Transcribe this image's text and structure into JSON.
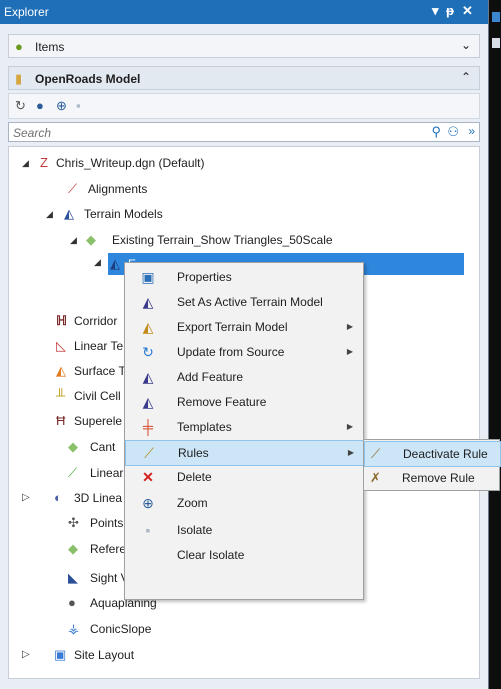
{
  "window": {
    "title": "Explorer",
    "pin": "↓ ‹",
    "close": "✕"
  },
  "sections": {
    "items": {
      "label": "Items",
      "chevron": "⌄"
    },
    "openroads": {
      "label": "OpenRoads Model",
      "chevron": "⌃"
    }
  },
  "search": {
    "placeholder": "Search"
  },
  "tree": {
    "root": "Chris_Writeup.dgn (Default)",
    "alignments": "Alignments",
    "terrain_models": "Terrain Models",
    "existing_terrain": "Existing Terrain_Show Triangles_50Scale",
    "selected_partial": "E",
    "corridors_partial": "Corridor",
    "linear_partial": "Linear Te",
    "surface_partial": "Surface T",
    "civil_cell_partial": "Civil Cell",
    "superelev_partial": "Superele",
    "cant": "Cant",
    "linear_g_partial": "Linear G",
    "threed_linear_partial": "3D Linea",
    "points": "Points",
    "reference_partial": "Referenc",
    "sight_visibility": "Sight Visibility Sections",
    "aquaplaning": "Aquaplaning",
    "conicslope": "ConicSlope",
    "site_layout": "Site Layout"
  },
  "context_menu": {
    "items": [
      {
        "label": "Properties",
        "has_submenu": false
      },
      {
        "label": "Set As Active Terrain Model",
        "has_submenu": false
      },
      {
        "label": "Export Terrain Model",
        "has_submenu": true
      },
      {
        "label": "Update from Source",
        "has_submenu": true
      },
      {
        "label": "Add Feature",
        "has_submenu": false
      },
      {
        "label": "Remove Feature",
        "has_submenu": false
      },
      {
        "label": "Templates",
        "has_submenu": true
      },
      {
        "label": "Rules",
        "has_submenu": true,
        "highlighted": true
      },
      {
        "label": "Delete",
        "has_submenu": false
      },
      {
        "label": "Zoom",
        "has_submenu": false
      },
      {
        "label": "Isolate",
        "has_submenu": false
      },
      {
        "label": "Clear Isolate",
        "has_submenu": false
      }
    ]
  },
  "rules_submenu": {
    "items": [
      {
        "label": "Deactivate Rule",
        "highlighted": true
      },
      {
        "label": "Remove Rule"
      }
    ]
  },
  "colors": {
    "titlebar": "#1f6fb8",
    "selection": "#2e87dc",
    "menu_highlight": "#cde6f7"
  }
}
